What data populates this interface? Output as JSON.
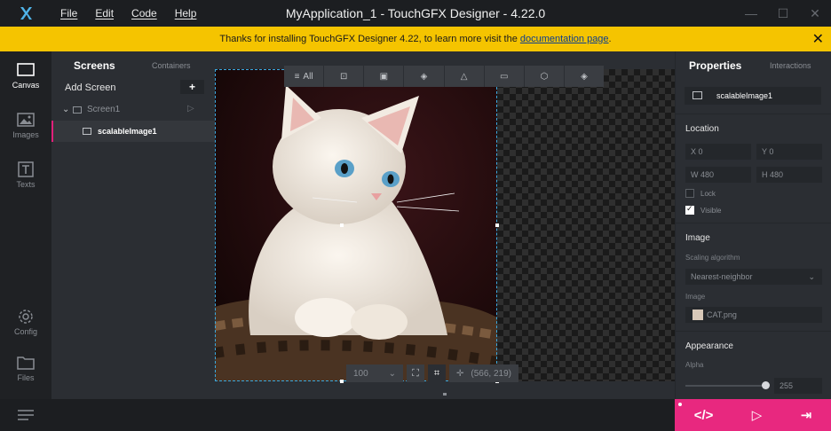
{
  "window": {
    "title": "MyApplication_1 - TouchGFX Designer - 4.22.0"
  },
  "menu": {
    "file": "File",
    "edit": "Edit",
    "code": "Code",
    "help": "Help"
  },
  "banner": {
    "text": "Thanks for installing TouchGFX Designer 4.22, to learn more visit the",
    "link": "documentation page",
    "suffix": "."
  },
  "nav": {
    "canvas": "Canvas",
    "images": "Images",
    "texts": "Texts",
    "config": "Config",
    "files": "Files"
  },
  "tree": {
    "tab_screens": "Screens",
    "tab_containers": "Containers",
    "add_screen": "Add Screen",
    "plus": "+",
    "screen1": "Screen1",
    "widget": "scalableImage1"
  },
  "toolbar": {
    "all": "All"
  },
  "canvas": {
    "zoom": "100",
    "coords": "(566, 219)"
  },
  "props": {
    "tab_properties": "Properties",
    "tab_interactions": "Interactions",
    "name": "scalableImage1",
    "location_title": "Location",
    "x_label": "X",
    "x": "0",
    "y_label": "Y",
    "y": "0",
    "w_label": "W",
    "w": "480",
    "h_label": "H",
    "h": "480",
    "lock": "Lock",
    "lock_checked": false,
    "visible": "Visible",
    "visible_checked": true,
    "image_title": "Image",
    "scaling_label": "Scaling algorithm",
    "scaling_value": "Nearest-neighbor",
    "image_label": "Image",
    "image_value": "CAT.png",
    "appearance_title": "Appearance",
    "alpha_label": "Alpha",
    "alpha_value": "255"
  },
  "colors": {
    "accent": "#e8287f",
    "banner": "#f5c400",
    "selection": "#3aa9e0"
  }
}
